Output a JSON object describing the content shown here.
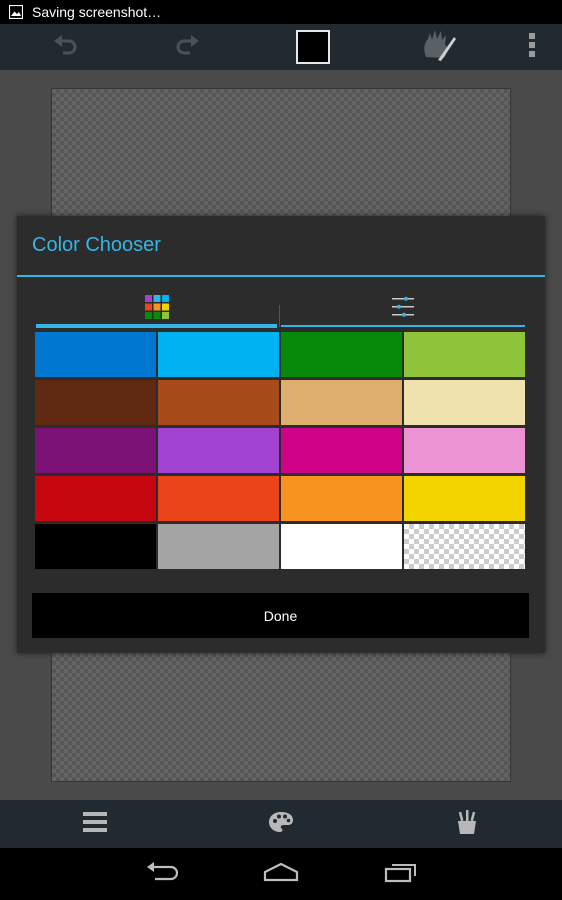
{
  "status_bar": {
    "text": "Saving screenshot…",
    "icon": "image-icon"
  },
  "action_bar": {
    "undo_icon": "undo-icon",
    "redo_icon": "redo-icon",
    "current_color": "#000000",
    "hand_icon": "hand-brush-icon",
    "overflow_icon": "overflow-menu-icon"
  },
  "dialog": {
    "title": "Color Chooser",
    "tabs": [
      {
        "icon": "color-grid-icon",
        "selected": true
      },
      {
        "icon": "sliders-icon",
        "selected": false
      }
    ],
    "swatches": [
      "#0077d0",
      "#00b2f0",
      "#078a09",
      "#8fc33a",
      "#602a12",
      "#a84b1a",
      "#ddae6d",
      "#efe2ac",
      "#7c1276",
      "#a242d0",
      "#cd0286",
      "#eb93d3",
      "#c7070f",
      "#ea4418",
      "#f7931e",
      "#f4d400",
      "#000000",
      "#a4a4a4",
      "#ffffff",
      "transparent"
    ],
    "done_label": "Done"
  },
  "bottom_toolbar": {
    "icons": [
      "menu-icon",
      "palette-icon",
      "brushes-icon"
    ]
  },
  "nav_bar": {
    "icons": [
      "back-icon",
      "home-icon",
      "recent-apps-icon"
    ]
  },
  "colors": {
    "accent": "#33b5e5",
    "toolbar": "#212a30",
    "dialog": "#2c2c2c"
  }
}
